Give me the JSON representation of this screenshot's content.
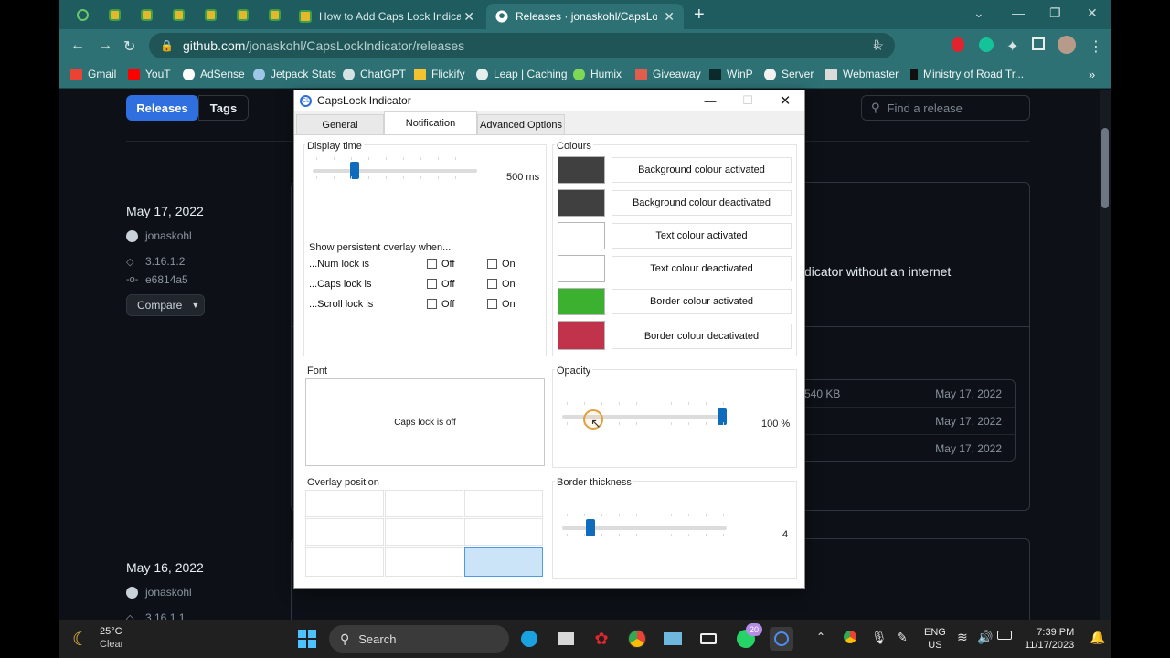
{
  "browser": {
    "tabs": [
      {
        "title": "How to Add Caps Lock Indicator"
      },
      {
        "title": "Releases · jonaskohl/CapsLockIn"
      }
    ],
    "url_host": "github.com",
    "url_path": "/jonaskohl/CapsLockIndicator/releases",
    "bookmarks": [
      "Gmail",
      "YouT",
      "AdSense",
      "Jetpack Stats",
      "ChatGPT",
      "Flickify",
      "Leap | Caching",
      "Humix",
      "Giveaway",
      "WinP",
      "Server",
      "Webmaster",
      "Ministry of Road Tr..."
    ],
    "more_label": "»"
  },
  "github": {
    "releases_label": "Releases",
    "tags_label": "Tags",
    "find_placeholder": "Find a release",
    "release1": {
      "date": "May 17, 2022",
      "author": "jonaskohl",
      "tag": "3.16.1.2",
      "commit": "e6814a5",
      "compare_label": "Compare",
      "desc_fragment": "dicator without an internet"
    },
    "assets": [
      {
        "size": "540 KB",
        "date": "May 17, 2022"
      },
      {
        "size": "",
        "date": "May 17, 2022"
      },
      {
        "size": "",
        "date": "May 17, 2022"
      }
    ],
    "release2": {
      "date": "May 16, 2022",
      "author": "jonaskohl",
      "tag": "3.16.1.1"
    }
  },
  "dialog": {
    "title": "CapsLock Indicator",
    "tabs": [
      "General",
      "Notification",
      "Advanced Options"
    ],
    "active_tab": "Notification",
    "display_time": {
      "label": "Display time",
      "value_text": "500 ms",
      "level_fraction": 0.24
    },
    "overlay": {
      "heading": "Show persistent overlay when...",
      "rows": [
        {
          "label": "...Num lock is",
          "off": "Off",
          "on": "On"
        },
        {
          "label": "...Caps lock is",
          "off": "Off",
          "on": "On"
        },
        {
          "label": "...Scroll lock is",
          "off": "Off",
          "on": "On"
        }
      ]
    },
    "colours": {
      "label": "Colours",
      "items": [
        {
          "label": "Background colour activated",
          "color": "#404040"
        },
        {
          "label": "Background colour deactivated",
          "color": "#404040"
        },
        {
          "label": "Text colour activated",
          "color": "#ffffff"
        },
        {
          "label": "Text colour deactivated",
          "color": "#ffffff"
        },
        {
          "label": "Border colour activated",
          "color": "#3cb02f"
        },
        {
          "label": "Border colour decativated",
          "color": "#c0334a"
        }
      ]
    },
    "font": {
      "label": "Font",
      "preview_text": "Caps lock is off"
    },
    "opacity": {
      "label": "Opacity",
      "value_text": "100 %",
      "level_fraction": 1.0
    },
    "overlay_position": {
      "label": "Overlay position",
      "selected": "bottom-right"
    },
    "border_thickness": {
      "label": "Border thickness",
      "value_text": "4",
      "level_fraction": 0.15
    }
  },
  "taskbar": {
    "temperature": "25°C",
    "condition": "Clear",
    "search_label": "Search",
    "badge_count": "20",
    "lang": "ENG",
    "region": "US",
    "time": "7:39 PM",
    "date": "11/17/2023"
  }
}
